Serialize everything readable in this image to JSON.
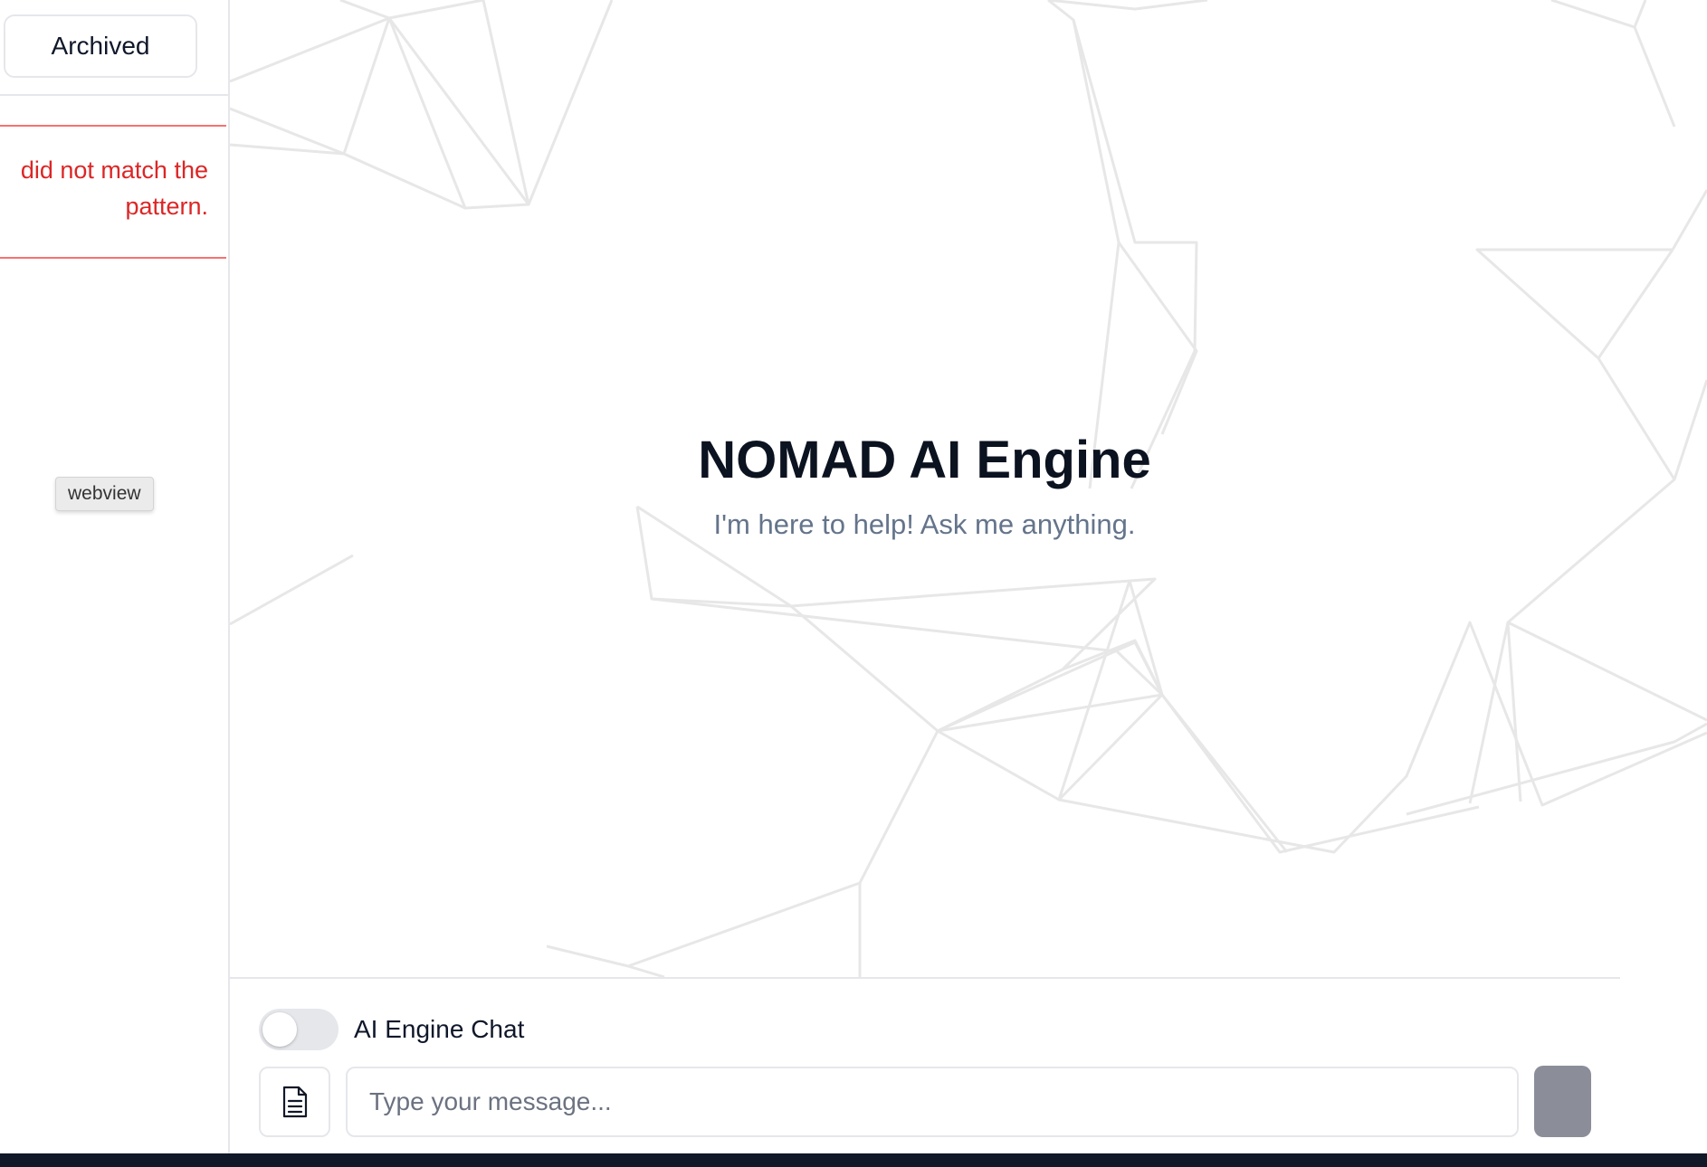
{
  "sidebar": {
    "archived_label": "Archived",
    "error_message": "did not match the\npattern.",
    "tooltip": "webview"
  },
  "main": {
    "title": "NOMAD AI Engine",
    "subtitle": "I'm here to help! Ask me anything."
  },
  "composer": {
    "toggle_label": "AI Engine Chat",
    "toggle_on": false,
    "input_placeholder": "Type your message...",
    "input_value": ""
  },
  "colors": {
    "error": "#dc2626",
    "send_button": "#8b8e98",
    "bottom_bar": "#111827"
  },
  "icons": {
    "file": "document-icon",
    "background": "network-mesh-pattern"
  }
}
